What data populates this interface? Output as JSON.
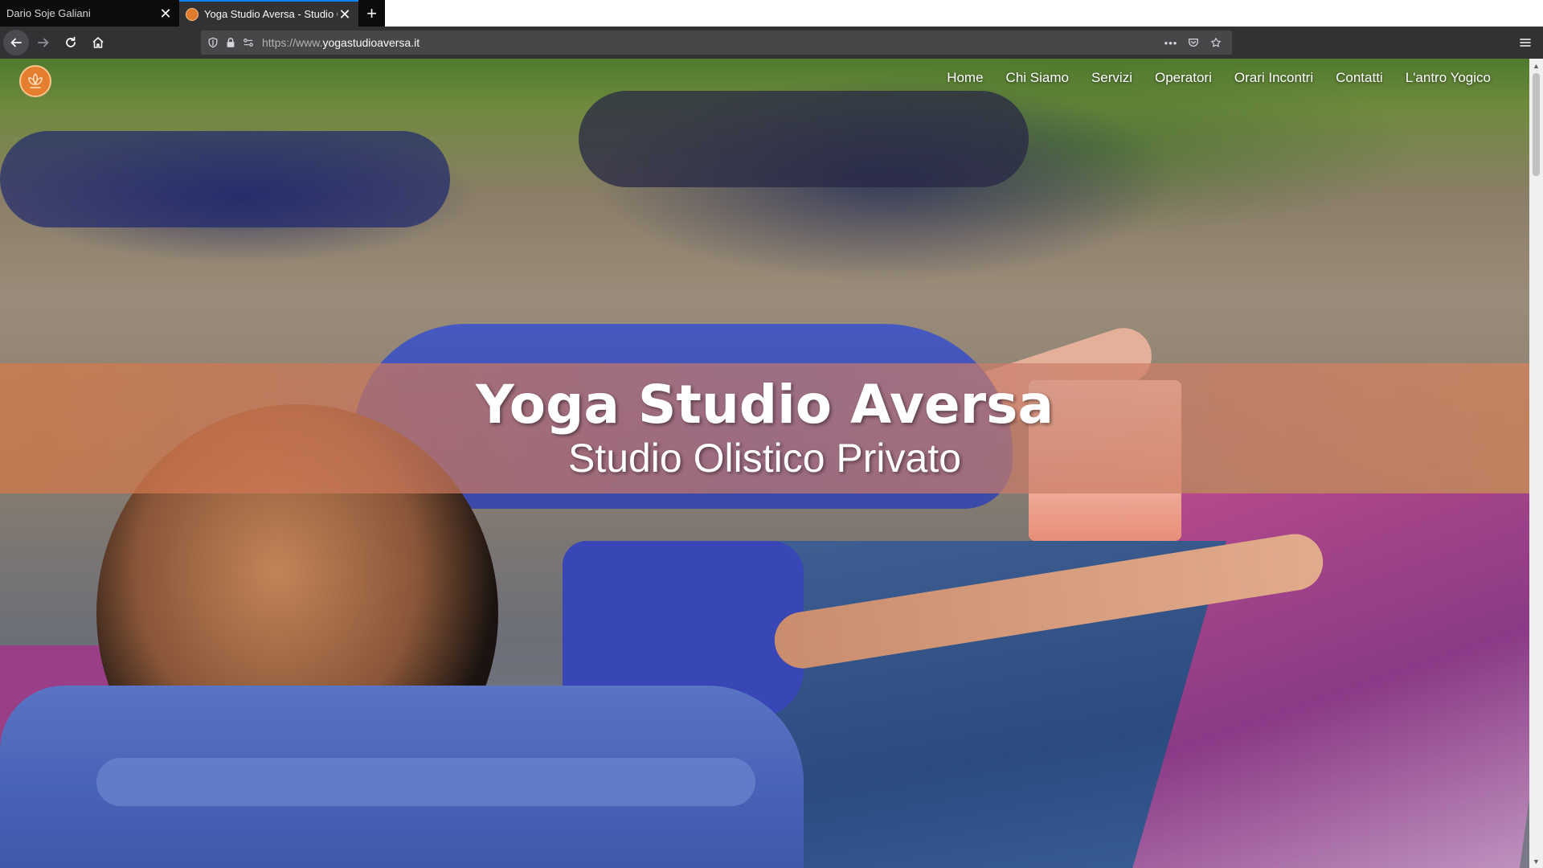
{
  "browser": {
    "tabs": [
      {
        "title": "Dario Soje Galiani",
        "active": false
      },
      {
        "title": "Yoga Studio Aversa - Studio Olistico Privato",
        "active": true
      }
    ],
    "new_tab_symbol": "+",
    "close_symbol": "✕",
    "url": {
      "prefix": "https://www.",
      "domain": "yogastudioaversa.it"
    },
    "page_actions_symbol": "•••",
    "icons": [
      "back-arrow-icon",
      "forward-arrow-icon",
      "reload-icon",
      "home-icon",
      "shield-icon",
      "lock-icon",
      "permissions-icon",
      "page-actions-icon",
      "pocket-icon",
      "bookmark-star-icon",
      "hamburger-menu-icon"
    ]
  },
  "site": {
    "nav": [
      "Home",
      "Chi Siamo",
      "Servizi",
      "Operatori",
      "Orari Incontri",
      "Contatti",
      "L'antro Yogico"
    ],
    "hero": {
      "title": "Yoga Studio Aversa",
      "subtitle": "Studio Olistico Privato"
    },
    "colors": {
      "banner_orange": "#d6784 6",
      "logo_orange": "#e57e2e"
    }
  }
}
